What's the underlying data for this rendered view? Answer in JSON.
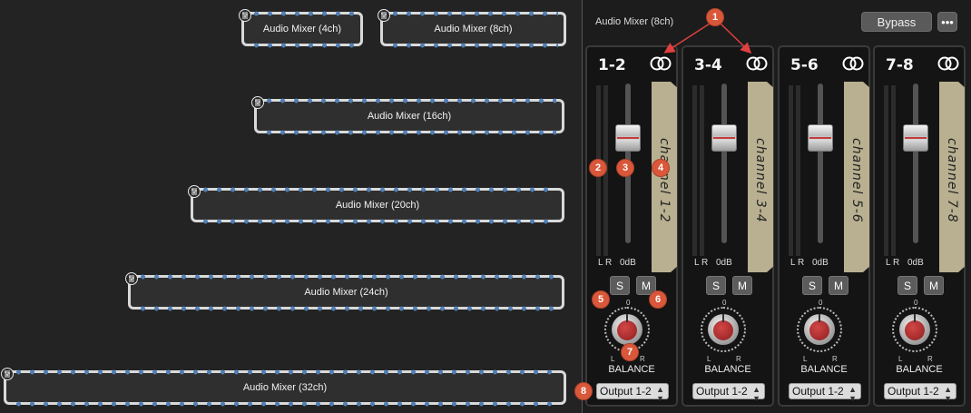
{
  "canvas": {
    "nodes": [
      {
        "label": "Audio Mixer (4ch)",
        "icon": "mixer-icon"
      },
      {
        "label": "Audio Mixer (8ch)",
        "icon": "mixer-icon"
      },
      {
        "label": "Audio Mixer (16ch)",
        "icon": "mixer-icon"
      },
      {
        "label": "Audio Mixer (20ch)",
        "icon": "mixer-icon"
      },
      {
        "label": "Audio Mixer (24ch)",
        "icon": "mixer-icon"
      },
      {
        "label": "Audio Mixer (32ch)",
        "icon": "mixer-icon"
      }
    ]
  },
  "panel": {
    "title": "Audio Mixer (8ch)",
    "bypass_label": "Bypass",
    "more_label": "•••",
    "strips": [
      {
        "label": "1-2",
        "scribble": "channel 1-2",
        "meter_left": "L",
        "meter_right": "R",
        "db": "0dB",
        "solo": "S",
        "mute": "M",
        "zero": "0",
        "bal_l": "L",
        "bal_r": "R",
        "balance": "BALANCE",
        "output": "Output 1-2"
      },
      {
        "label": "3-4",
        "scribble": "channel 3-4",
        "meter_left": "L",
        "meter_right": "R",
        "db": "0dB",
        "solo": "S",
        "mute": "M",
        "zero": "0",
        "bal_l": "L",
        "bal_r": "R",
        "balance": "BALANCE",
        "output": "Output 1-2"
      },
      {
        "label": "5-6",
        "scribble": "channel 5-6",
        "meter_left": "L",
        "meter_right": "R",
        "db": "0dB",
        "solo": "S",
        "mute": "M",
        "zero": "0",
        "bal_l": "L",
        "bal_r": "R",
        "balance": "BALANCE",
        "output": "Output 1-2"
      },
      {
        "label": "7-8",
        "scribble": "channel 7-8",
        "meter_left": "L",
        "meter_right": "R",
        "db": "0dB",
        "solo": "S",
        "mute": "M",
        "zero": "0",
        "bal_l": "L",
        "bal_r": "R",
        "balance": "BALANCE",
        "output": "Output 1-2"
      }
    ]
  },
  "callouts": [
    "1",
    "2",
    "3",
    "4",
    "5",
    "6",
    "7",
    "8"
  ],
  "colors": {
    "canvas_bg": "#232323",
    "node_border": "#d9d9d9",
    "port": "#4f7fb4",
    "callout": "#d9573a",
    "scribble_strip": "#b8b090",
    "knob_red": "#c23434"
  }
}
